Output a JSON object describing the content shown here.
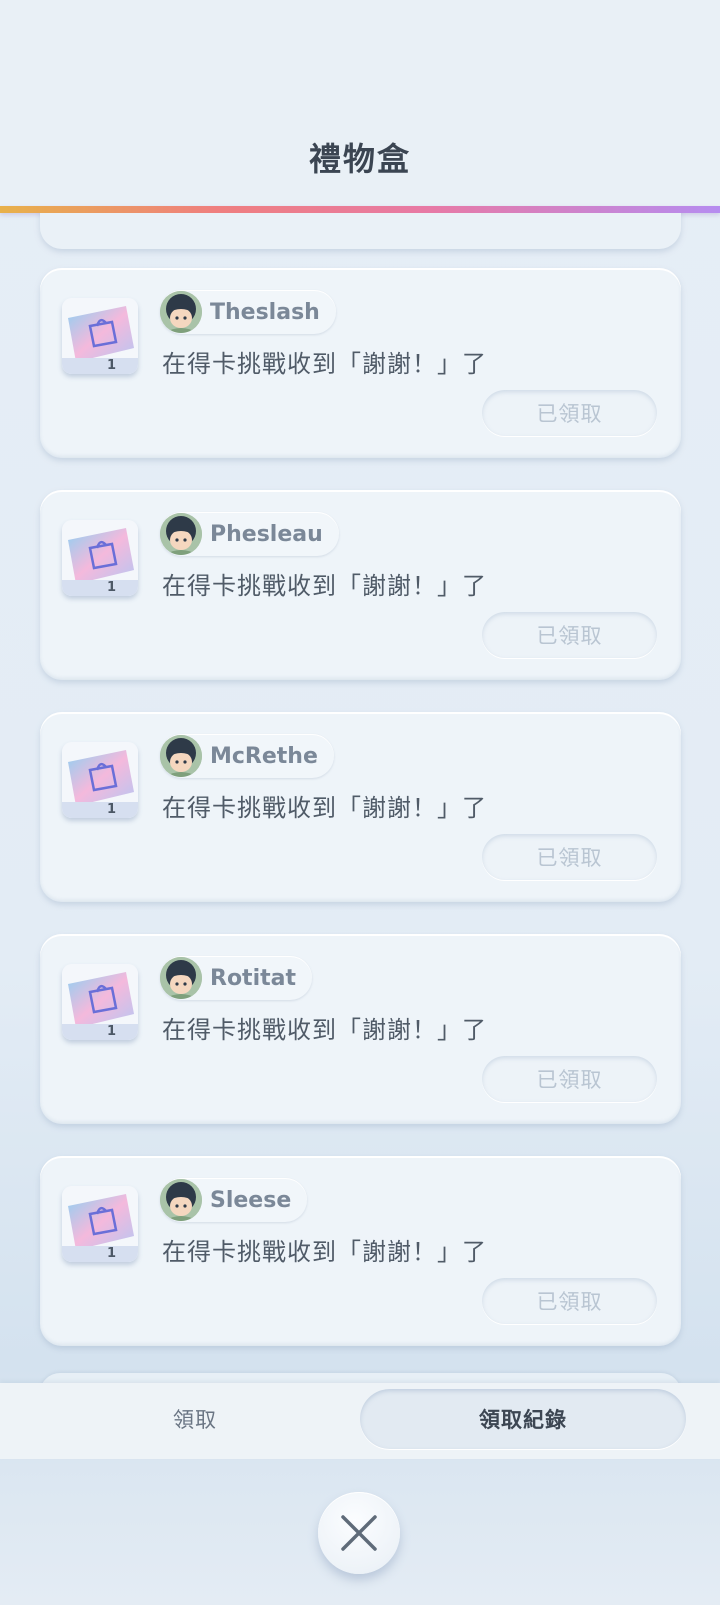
{
  "header": {
    "title": "禮物盒"
  },
  "gifts": [
    {
      "user": "Theslash",
      "message": "在得卡挑戰收到「謝謝！」了",
      "quantity": "1",
      "status": "已領取"
    },
    {
      "user": "Phesleau",
      "message": "在得卡挑戰收到「謝謝！」了",
      "quantity": "1",
      "status": "已領取"
    },
    {
      "user": "McRethe",
      "message": "在得卡挑戰收到「謝謝！」了",
      "quantity": "1",
      "status": "已領取"
    },
    {
      "user": "Rotitat",
      "message": "在得卡挑戰收到「謝謝！」了",
      "quantity": "1",
      "status": "已領取"
    },
    {
      "user": "Sleese",
      "message": "在得卡挑戰收到「謝謝！」了",
      "quantity": "1",
      "status": "已領取"
    }
  ],
  "tabs": {
    "claim": "領取",
    "history": "領取紀錄"
  },
  "icons": {
    "gift": "gift-bag-icon",
    "avatar": "user-avatar-icon",
    "close": "close-icon"
  },
  "colors": {
    "accent_start": "#e8b14a",
    "accent_mid": "#e77aa6",
    "accent_end": "#b68cf0"
  }
}
